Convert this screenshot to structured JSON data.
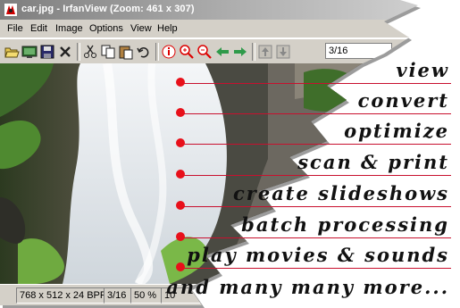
{
  "window": {
    "title": "car.jpg - IrfanView (Zoom: 461 x 307)"
  },
  "menu": [
    "File",
    "Edit",
    "Image",
    "Options",
    "View",
    "Help"
  ],
  "toolbar": {
    "buttons": [
      {
        "name": "open-icon"
      },
      {
        "name": "slideshow-icon"
      },
      {
        "name": "save-icon"
      },
      {
        "name": "delete-icon"
      },
      {
        "name": "cut-icon"
      },
      {
        "name": "copy-icon"
      },
      {
        "name": "paste-icon"
      },
      {
        "name": "undo-icon"
      },
      {
        "name": "info-icon"
      },
      {
        "name": "zoom-in-icon"
      },
      {
        "name": "zoom-out-icon"
      },
      {
        "name": "previous-icon"
      },
      {
        "name": "next-icon"
      },
      {
        "name": "first-icon"
      },
      {
        "name": "last-icon"
      }
    ],
    "page_indicator": "3/16"
  },
  "status": {
    "dimensions": "768 x 512 x 24 BPP",
    "page": "3/16",
    "zoom": "50 %",
    "extra": "10"
  },
  "features": [
    "view",
    "convert",
    "optimize",
    "scan & print",
    "create slideshows",
    "batch processing",
    "play movies & sounds",
    "and many many more..."
  ],
  "colors": {
    "accent_red": "#e8101a",
    "line_red": "#c8102e",
    "window_face": "#d4d0c8"
  }
}
